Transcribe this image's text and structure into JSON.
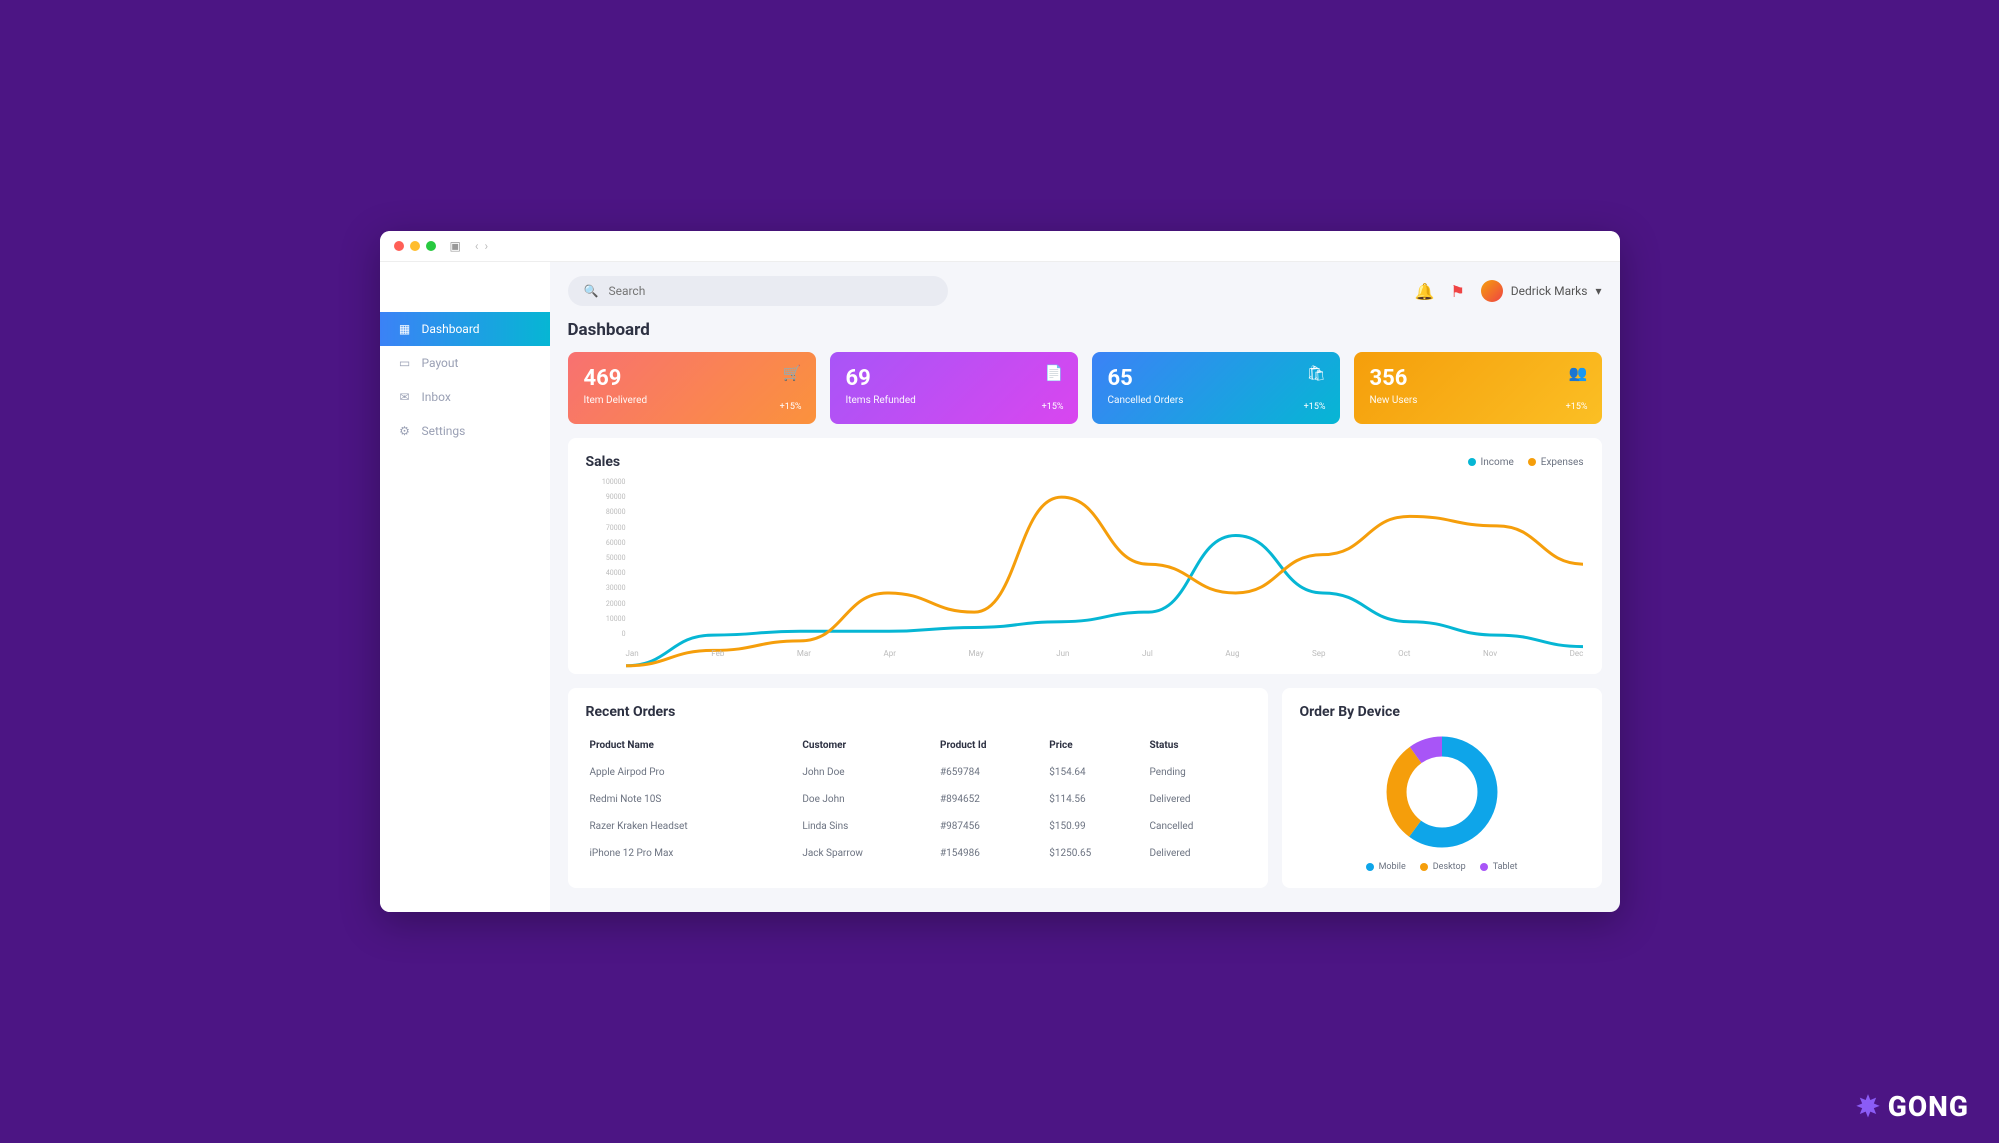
{
  "search": {
    "placeholder": "Search"
  },
  "user": {
    "name": "Dedrick Marks"
  },
  "pageTitle": "Dashboard",
  "sidebar": {
    "items": [
      {
        "label": "Dashboard"
      },
      {
        "label": "Payout"
      },
      {
        "label": "Inbox"
      },
      {
        "label": "Settings"
      }
    ]
  },
  "cards": [
    {
      "value": "469",
      "label": "Item Delivered",
      "delta": "+15%"
    },
    {
      "value": "69",
      "label": "Items Refunded",
      "delta": "+15%"
    },
    {
      "value": "65",
      "label": "Cancelled Orders",
      "delta": "+15%"
    },
    {
      "value": "356",
      "label": "New Users",
      "delta": "+15%"
    }
  ],
  "sales": {
    "title": "Sales",
    "legend": {
      "income": "Income",
      "expenses": "Expenses"
    }
  },
  "orders": {
    "title": "Recent Orders",
    "headers": {
      "product": "Product Name",
      "customer": "Customer",
      "pid": "Product Id",
      "price": "Price",
      "status": "Status"
    },
    "rows": [
      {
        "product": "Apple Airpod Pro",
        "customer": "John Doe",
        "pid": "#659784",
        "price": "$154.64",
        "status": "Pending",
        "class": "st-pending"
      },
      {
        "product": "Redmi Note 10S",
        "customer": "Doe John",
        "pid": "#894652",
        "price": "$114.56",
        "status": "Delivered",
        "class": "st-delivered"
      },
      {
        "product": "Razer Kraken Headset",
        "customer": "Linda Sins",
        "pid": "#987456",
        "price": "$150.99",
        "status": "Cancelled",
        "class": "st-cancelled"
      },
      {
        "product": "iPhone 12 Pro Max",
        "customer": "Jack Sparrow",
        "pid": "#154986",
        "price": "$1250.65",
        "status": "Delivered",
        "class": "st-delivered"
      }
    ]
  },
  "device": {
    "title": "Order By Device",
    "legend": {
      "mobile": "Mobile",
      "desktop": "Desktop",
      "tablet": "Tablet"
    }
  },
  "brand": "GONG",
  "chart_data": [
    {
      "type": "line",
      "title": "Sales",
      "xlabel": "",
      "ylabel": "",
      "ylim": [
        0,
        100000
      ],
      "categories": [
        "Jan",
        "Feb",
        "Mar",
        "Apr",
        "May",
        "Jun",
        "Jul",
        "Aug",
        "Sep",
        "Oct",
        "Nov",
        "Dec"
      ],
      "yticks": [
        0,
        10000,
        20000,
        30000,
        40000,
        50000,
        60000,
        70000,
        80000,
        90000,
        100000
      ],
      "series": [
        {
          "name": "Income",
          "color": "#06b6d4",
          "values": [
            2000,
            18000,
            20000,
            20000,
            22000,
            25000,
            30000,
            70000,
            40000,
            25000,
            18000,
            12000
          ]
        },
        {
          "name": "Expenses",
          "color": "#f59e0b",
          "values": [
            2000,
            10000,
            15000,
            40000,
            30000,
            90000,
            55000,
            40000,
            60000,
            80000,
            75000,
            55000
          ]
        }
      ]
    },
    {
      "type": "pie",
      "title": "Order By Device",
      "series": [
        {
          "name": "Mobile",
          "value": 60,
          "color": "#0ea5e9"
        },
        {
          "name": "Desktop",
          "value": 30,
          "color": "#f59e0b"
        },
        {
          "name": "Tablet",
          "value": 10,
          "color": "#a855f7"
        }
      ]
    }
  ]
}
